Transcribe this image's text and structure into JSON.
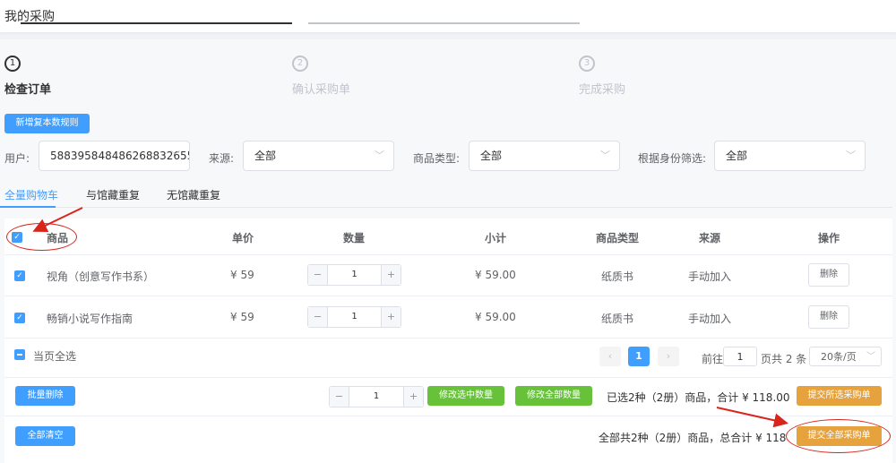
{
  "page": {
    "title": "我的采购"
  },
  "steps": [
    {
      "number": "1",
      "label": "检查订单"
    },
    {
      "number": "2",
      "label": "确认采购单"
    },
    {
      "number": "3",
      "label": "完成采购"
    }
  ],
  "toolbar": {
    "add_rule_label": "新增复本数规则"
  },
  "filters": {
    "user_label": "用户:",
    "user_value": "588395848486268832655",
    "source_label": "来源:",
    "source_value": "全部",
    "type_label": "商品类型:",
    "type_value": "全部",
    "identity_label": "根据身份筛选:",
    "identity_value": "全部"
  },
  "tabs": [
    "全量购物车",
    "与馆藏重复",
    "无馆藏重复"
  ],
  "table": {
    "headers": {
      "product": "商品",
      "price": "单价",
      "qty": "数量",
      "subtotal": "小计",
      "type": "商品类型",
      "source": "来源",
      "action": "操作"
    },
    "rows": [
      {
        "name": "视角（创意写作书系）",
        "price": "¥ 59",
        "qty": "1",
        "subtotal": "¥ 59.00",
        "type": "纸质书",
        "source": "手动加入",
        "action": "删除"
      },
      {
        "name": "畅销小说写作指南",
        "price": "¥ 59",
        "qty": "1",
        "subtotal": "¥ 59.00",
        "type": "纸质书",
        "source": "手动加入",
        "action": "删除"
      }
    ]
  },
  "footer": {
    "select_page_label": "当页全选",
    "pager": {
      "current": "1",
      "goto_label": "前往",
      "goto_value": "1",
      "total_label": "页共 2 条",
      "page_size": "20条/页",
      "prev": "‹",
      "next": "›"
    },
    "batch_delete": "批量删除",
    "bottom_qty": "1",
    "modify_selected": "修改选中数量",
    "modify_all": "修改全部数量",
    "selected_summary": "已选2种（2册）商品，合计 ¥ 118.00",
    "submit_selected": "提交所选采购单",
    "clear_all": "全部清空",
    "all_summary": "全部共2种（2册）商品，总合计 ¥ 118",
    "submit_all": "提交全部采购单"
  },
  "icons": {
    "check": "✓",
    "chevron": "﹀",
    "minus": "−",
    "plus": "+"
  },
  "colors": {
    "primary": "#409eff",
    "success": "#67c23a",
    "warning": "#e6a23c",
    "annotation": "#d9261c"
  }
}
